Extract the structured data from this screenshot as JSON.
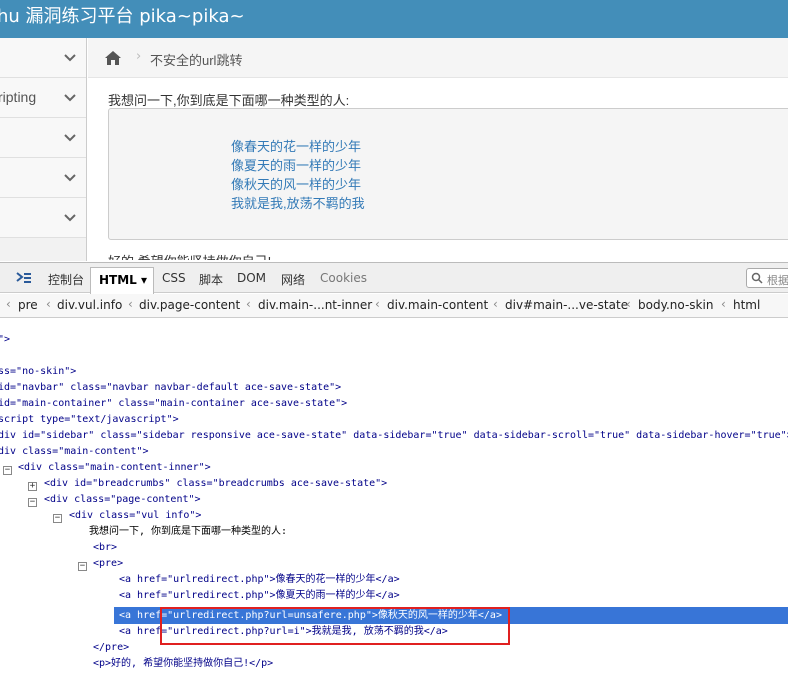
{
  "header": {
    "title": "hu 漏洞练习平台 pika~pika~"
  },
  "sidebar": {
    "items": [
      {
        "label": ""
      },
      {
        "label": "ripting"
      },
      {
        "label": ""
      },
      {
        "label": ""
      },
      {
        "label": ""
      }
    ]
  },
  "breadcrumb": {
    "current": "不安全的url跳转"
  },
  "content": {
    "question": "我想问一下,你到底是下面哪一种类型的人:",
    "links": [
      "像春天的花一样的少年",
      "像夏天的雨一样的少年",
      "像秋天的风一样的少年",
      "我就是我,放荡不羁的我"
    ],
    "footer": "好的,希望你能坚持做你自己!"
  },
  "devtools": {
    "tabs": [
      "控制台",
      "HTML",
      "CSS",
      "脚本",
      "DOM",
      "网络",
      "Cookies"
    ],
    "search_placeholder": "根据",
    "path": [
      "pre",
      "div.vul.info",
      "div.page-content",
      "div.main-...nt-inner",
      "div.main-content",
      "div#main-...ve-state",
      "body.no-skin",
      "html"
    ],
    "lines": [
      {
        "t": "\">"
      },
      {
        "t": "ss=\"no-skin\">"
      },
      {
        "t": "id=\"navbar\" class=\"navbar navbar-default ace-save-state\">"
      },
      {
        "t": "id=\"main-container\" class=\"main-container ace-save-state\">"
      },
      {
        "t": "script type=\"text/javascript\">"
      },
      {
        "t": "div id=\"sidebar\" class=\"sidebar responsive ace-save-state\" data-sidebar=\"true\" data-sidebar-scroll=\"true\" data-sidebar-hover=\"true\">"
      },
      {
        "t": "div class=\"main-content\">"
      },
      {
        "t": "<div class=\"main-content-inner\">"
      },
      {
        "t": "<div id=\"breadcrumbs\" class=\"breadcrumbs ace-save-state\">"
      },
      {
        "t": "<div class=\"page-content\">"
      },
      {
        "t": "<div class=\"vul info\">"
      },
      {
        "t": "我想问一下, 你到底是下面哪一种类型的人:"
      },
      {
        "t": "<br>"
      },
      {
        "t": "<pre>"
      },
      {
        "t": "<a href=\"urlredirect.php\">像春天的花一样的少年</a>"
      },
      {
        "t": "<a href=\"urlredirect.php\">像夏天的雨一样的少年</a>"
      },
      {
        "t": "<a href=\"urlredirect.php?url=unsafere.php\">像秋天的风一样的少年</a>"
      },
      {
        "t": "<a href=\"urlredirect.php?url=i\">我就是我, 放荡不羁的我</a>"
      },
      {
        "t": "</pre>"
      },
      {
        "t": "<p>好的, 希望你能坚持做你自己!</p>"
      }
    ]
  },
  "colors": {
    "navbar": "#438eb9",
    "link": "#337ab7",
    "selection": "#3875d7",
    "highlight_box": "#e02020"
  }
}
